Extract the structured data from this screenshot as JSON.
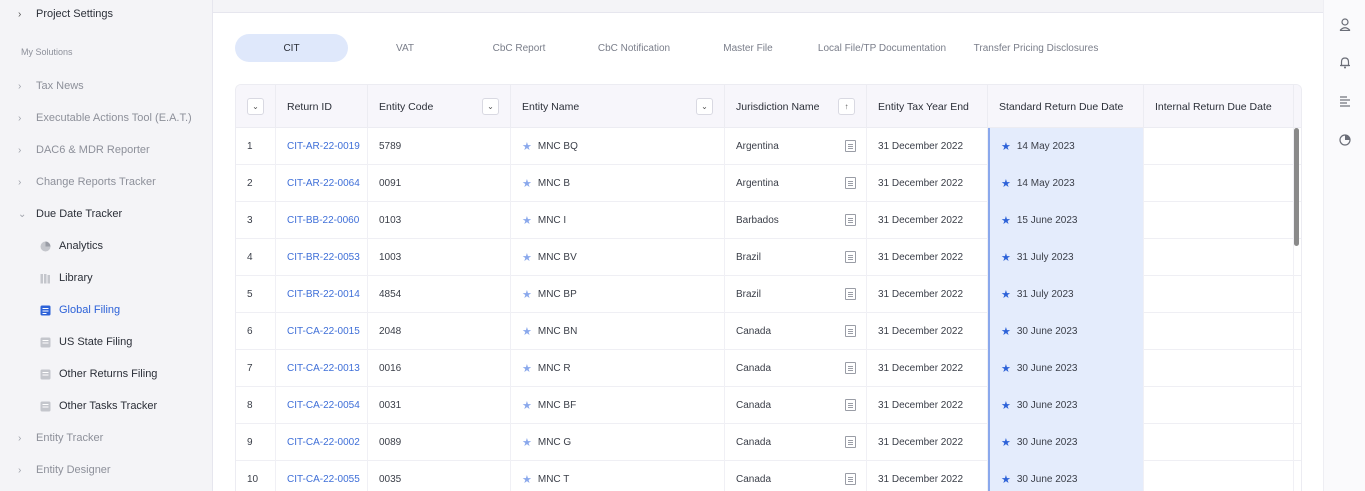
{
  "sidebar": {
    "project_settings": "Project Settings",
    "section_label": "My Solutions",
    "items": [
      {
        "label": "Tax News"
      },
      {
        "label": "Executable Actions Tool (E.A.T.)"
      },
      {
        "label": "DAC6 & MDR Reporter"
      },
      {
        "label": "Change Reports Tracker"
      },
      {
        "label": "Due Date Tracker"
      },
      {
        "label": "Entity Tracker"
      },
      {
        "label": "Entity Designer"
      }
    ],
    "sub_items": [
      {
        "label": "Analytics",
        "icon": "pie-chart-icon"
      },
      {
        "label": "Library",
        "icon": "library-icon"
      },
      {
        "label": "Global Filing",
        "icon": "document-icon",
        "active": true
      },
      {
        "label": "US State Filing",
        "icon": "document-icon"
      },
      {
        "label": "Other Returns Filing",
        "icon": "document-icon"
      },
      {
        "label": "Other Tasks Tracker",
        "icon": "document-icon"
      }
    ]
  },
  "tabs": [
    {
      "label": "CIT",
      "active": true
    },
    {
      "label": "VAT"
    },
    {
      "label": "CbC Report"
    },
    {
      "label": "CbC Notification"
    },
    {
      "label": "Master File"
    },
    {
      "label": "Local File/TP Documentation"
    },
    {
      "label": "Transfer Pricing Disclosures"
    }
  ],
  "table": {
    "headers": {
      "return_id": "Return ID",
      "entity_code": "Entity Code",
      "entity_name": "Entity Name",
      "jurisdiction": "Jurisdiction Name",
      "tax_year_end": "Entity Tax Year End",
      "std_due": "Standard Return Due Date",
      "int_due": "Internal Return Due Date"
    },
    "rows": [
      {
        "n": "1",
        "id": "CIT-AR-22-0019",
        "code": "5789",
        "name": "MNC BQ",
        "jur": "Argentina",
        "tye": "31 December 2022",
        "due": "14 May 2023"
      },
      {
        "n": "2",
        "id": "CIT-AR-22-0064",
        "code": "0091",
        "name": "MNC B",
        "jur": "Argentina",
        "tye": "31 December 2022",
        "due": "14 May 2023"
      },
      {
        "n": "3",
        "id": "CIT-BB-22-0060",
        "code": "0103",
        "name": "MNC I",
        "jur": "Barbados",
        "tye": "31 December 2022",
        "due": "15 June 2023"
      },
      {
        "n": "4",
        "id": "CIT-BR-22-0053",
        "code": "1003",
        "name": "MNC BV",
        "jur": "Brazil",
        "tye": "31 December 2022",
        "due": "31 July 2023"
      },
      {
        "n": "5",
        "id": "CIT-BR-22-0014",
        "code": "4854",
        "name": "MNC BP",
        "jur": "Brazil",
        "tye": "31 December 2022",
        "due": "31 July 2023"
      },
      {
        "n": "6",
        "id": "CIT-CA-22-0015",
        "code": "2048",
        "name": "MNC BN",
        "jur": "Canada",
        "tye": "31 December 2022",
        "due": "30 June 2023"
      },
      {
        "n": "7",
        "id": "CIT-CA-22-0013",
        "code": "0016",
        "name": "MNC R",
        "jur": "Canada",
        "tye": "31 December 2022",
        "due": "30 June 2023"
      },
      {
        "n": "8",
        "id": "CIT-CA-22-0054",
        "code": "0031",
        "name": "MNC BF",
        "jur": "Canada",
        "tye": "31 December 2022",
        "due": "30 June 2023"
      },
      {
        "n": "9",
        "id": "CIT-CA-22-0002",
        "code": "0089",
        "name": "MNC G",
        "jur": "Canada",
        "tye": "31 December 2022",
        "due": "30 June 2023"
      },
      {
        "n": "10",
        "id": "CIT-CA-22-0055",
        "code": "0035",
        "name": "MNC T",
        "jur": "Canada",
        "tye": "31 December 2022",
        "due": "30 June 2023"
      }
    ]
  },
  "colors": {
    "accent": "#2d62d8",
    "tab_active_bg": "#dfe8fb",
    "due_bg": "#e4ecfc"
  },
  "rail_icons": [
    "user-icon",
    "bell-icon",
    "list-icon",
    "pie-chart-icon"
  ]
}
